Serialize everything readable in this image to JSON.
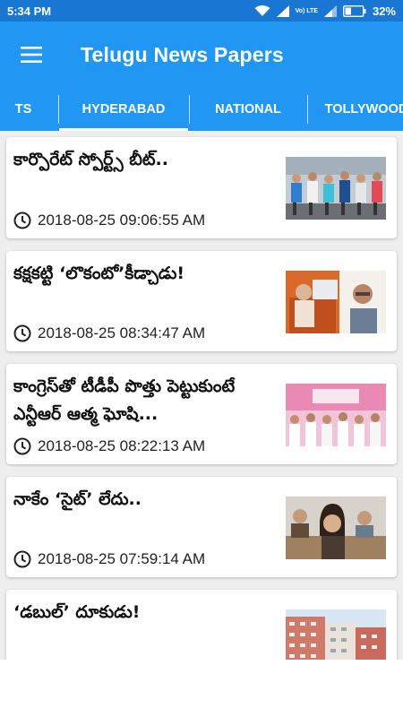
{
  "status_bar": {
    "time": "5:34 PM",
    "battery": "32%",
    "network_label": "Vo) LTE",
    "icons": [
      "wifi-icon",
      "signal-icon",
      "volte-icon",
      "signal-icon",
      "battery-icon"
    ]
  },
  "app_bar": {
    "title": "Telugu News Papers",
    "menu_icon": "hamburger-menu-icon"
  },
  "tabs": [
    {
      "label": "TS",
      "selected": false
    },
    {
      "label": "HYDERABAD",
      "selected": true
    },
    {
      "label": "NATIONAL",
      "selected": false
    },
    {
      "label": "TOLLYWOOD",
      "selected": false
    }
  ],
  "articles": [
    {
      "title": "కార్పొరేట్ స్పోర్ట్స్ బీట్..",
      "time": "2018-08-25 09:06:55 AM",
      "image": "marathon-runners-photo"
    },
    {
      "title": "కక్షకట్టి ‘లొకంటో’కీడ్చాడు!",
      "time": "2018-08-25 08:34:47 AM",
      "image": "woman-at-computer-and-man-portrait-photo"
    },
    {
      "title": "కాంగ్రెస్‌తో టీడీపీ పొత్తు పెట్టుకుంటే ఎన్టీఆర్ ఆత్మ ఘోషి...",
      "time": "2018-08-25 08:22:13 AM",
      "image": "political-stage-photo"
    },
    {
      "title": "నాకేం ‘సైట్’ లేదు..",
      "time": "2018-08-25 07:59:14 AM",
      "image": "students-in-classroom-photo"
    },
    {
      "title": "‘డబుల్’ దూకుడు!",
      "time": "",
      "image": "housing-buildings-photo"
    }
  ],
  "colors": {
    "status_bar": "#1976d2",
    "app_bar": "#2196f3",
    "card": "#ffffff",
    "background": "#eeeeee"
  }
}
